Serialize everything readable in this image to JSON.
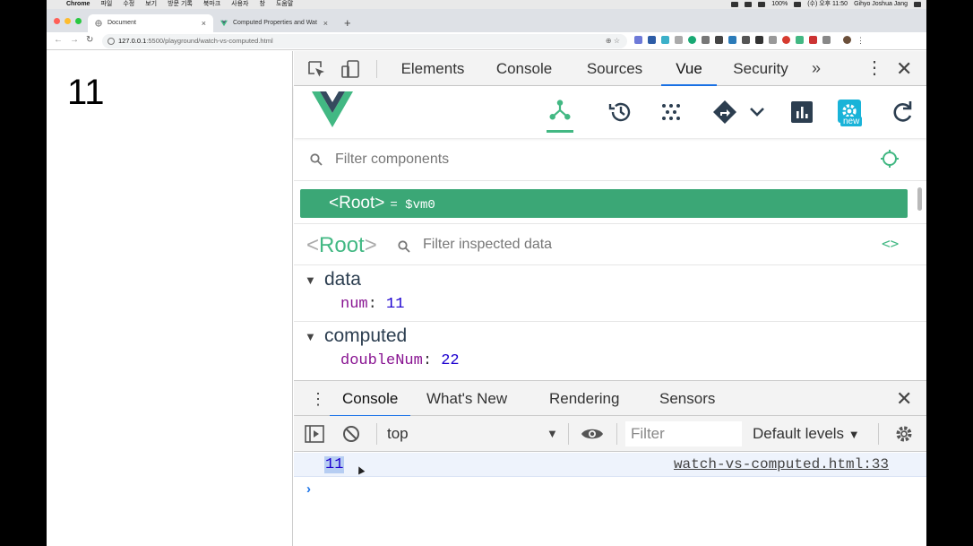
{
  "menubar": {
    "app": "Chrome",
    "menus": [
      "파일",
      "수정",
      "보기",
      "방문 기록",
      "북마크",
      "사용자",
      "창",
      "도움말"
    ],
    "battery": "100%",
    "clock": "(수) 오후 11:50",
    "user": "Gihyo Joshua Jang"
  },
  "browser": {
    "tabs": [
      {
        "title": "Document",
        "active": true
      },
      {
        "title": "Computed Properties and Wat",
        "active": false
      }
    ],
    "url_host": "127.0.0.1",
    "url_path": ":5500/playground/watch-vs-computed.html"
  },
  "page": {
    "value": "11"
  },
  "devtools": {
    "tabs": [
      "Elements",
      "Console",
      "Sources",
      "Vue",
      "Security"
    ],
    "active_tab": "Vue",
    "vue": {
      "filter_components_placeholder": "Filter components",
      "new_badge": "new",
      "root_component": "Root",
      "root_vm": "= $vm0",
      "inspected_name": "Root",
      "filter_inspected_placeholder": "Filter inspected data",
      "sections": {
        "data": {
          "title": "data",
          "key": "num",
          "value": "11"
        },
        "computed": {
          "title": "computed",
          "key": "doubleNum",
          "value": "22"
        }
      }
    },
    "drawer": {
      "tabs": [
        "Console",
        "What's New",
        "Rendering",
        "Sensors"
      ],
      "active": "Console",
      "context": "top",
      "filter_placeholder": "Filter",
      "levels": "Default levels",
      "log": {
        "value": "11",
        "source": "watch-vs-computed.html:33"
      },
      "prompt": "›"
    }
  },
  "colors": {
    "vue_green": "#42b883",
    "root_row": "#3ba776",
    "chrome_blue": "#1a73e8"
  }
}
